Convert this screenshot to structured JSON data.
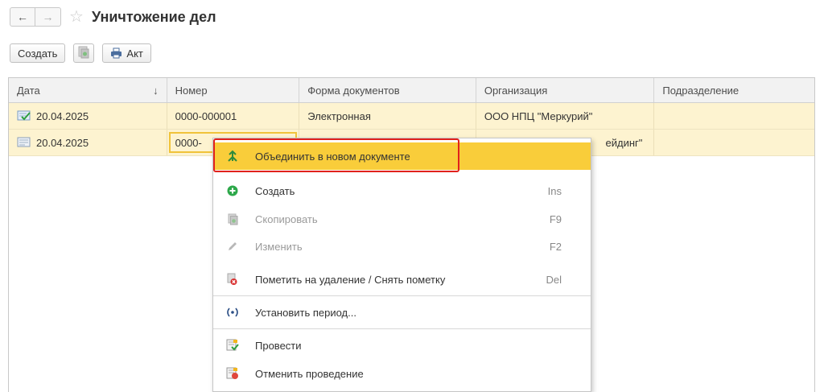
{
  "header": {
    "title": "Уничтожение дел",
    "back_icon": "←",
    "forward_icon": "→",
    "favorite_icon": "☆"
  },
  "toolbar": {
    "create_label": "Создать",
    "print_label": "Акт"
  },
  "table": {
    "columns": [
      "Дата",
      "Номер",
      "Форма документов",
      "Организация",
      "Подразделение"
    ],
    "sort_indicator": "↓",
    "rows": [
      {
        "date": "20.04.2025",
        "number": "0000-000001",
        "form": "Электронная",
        "org": "ООО НПЦ \"Меркурий\"",
        "dept": "",
        "status": "posted"
      },
      {
        "date": "20.04.2025",
        "number": "0000-",
        "form": "",
        "org": "ейдинг\"",
        "dept": "",
        "status": "draft"
      }
    ]
  },
  "context_menu": {
    "items": [
      {
        "label": "Объединить в новом документе",
        "shortcut": "",
        "icon": "merge-icon",
        "highlighted": true
      },
      {
        "label": "Создать",
        "shortcut": "Ins",
        "icon": "add-icon"
      },
      {
        "label": "Скопировать",
        "shortcut": "F9",
        "icon": "copy-icon",
        "disabled": true
      },
      {
        "label": "Изменить",
        "shortcut": "F2",
        "icon": "edit-icon",
        "disabled": true
      },
      {
        "label": "Пометить на удаление / Снять пометку",
        "shortcut": "Del",
        "icon": "delete-mark-icon"
      },
      {
        "label": "Установить период...",
        "shortcut": "",
        "icon": "period-icon"
      },
      {
        "label": "Провести",
        "shortcut": "",
        "icon": "post-icon"
      },
      {
        "label": "Отменить проведение",
        "shortcut": "",
        "icon": "unpost-icon"
      }
    ]
  },
  "colors": {
    "row_background": "#fdf3d0",
    "menu_highlight": "#f9cd3a",
    "callout_border": "#e1221c",
    "add_green": "#2da84a"
  }
}
